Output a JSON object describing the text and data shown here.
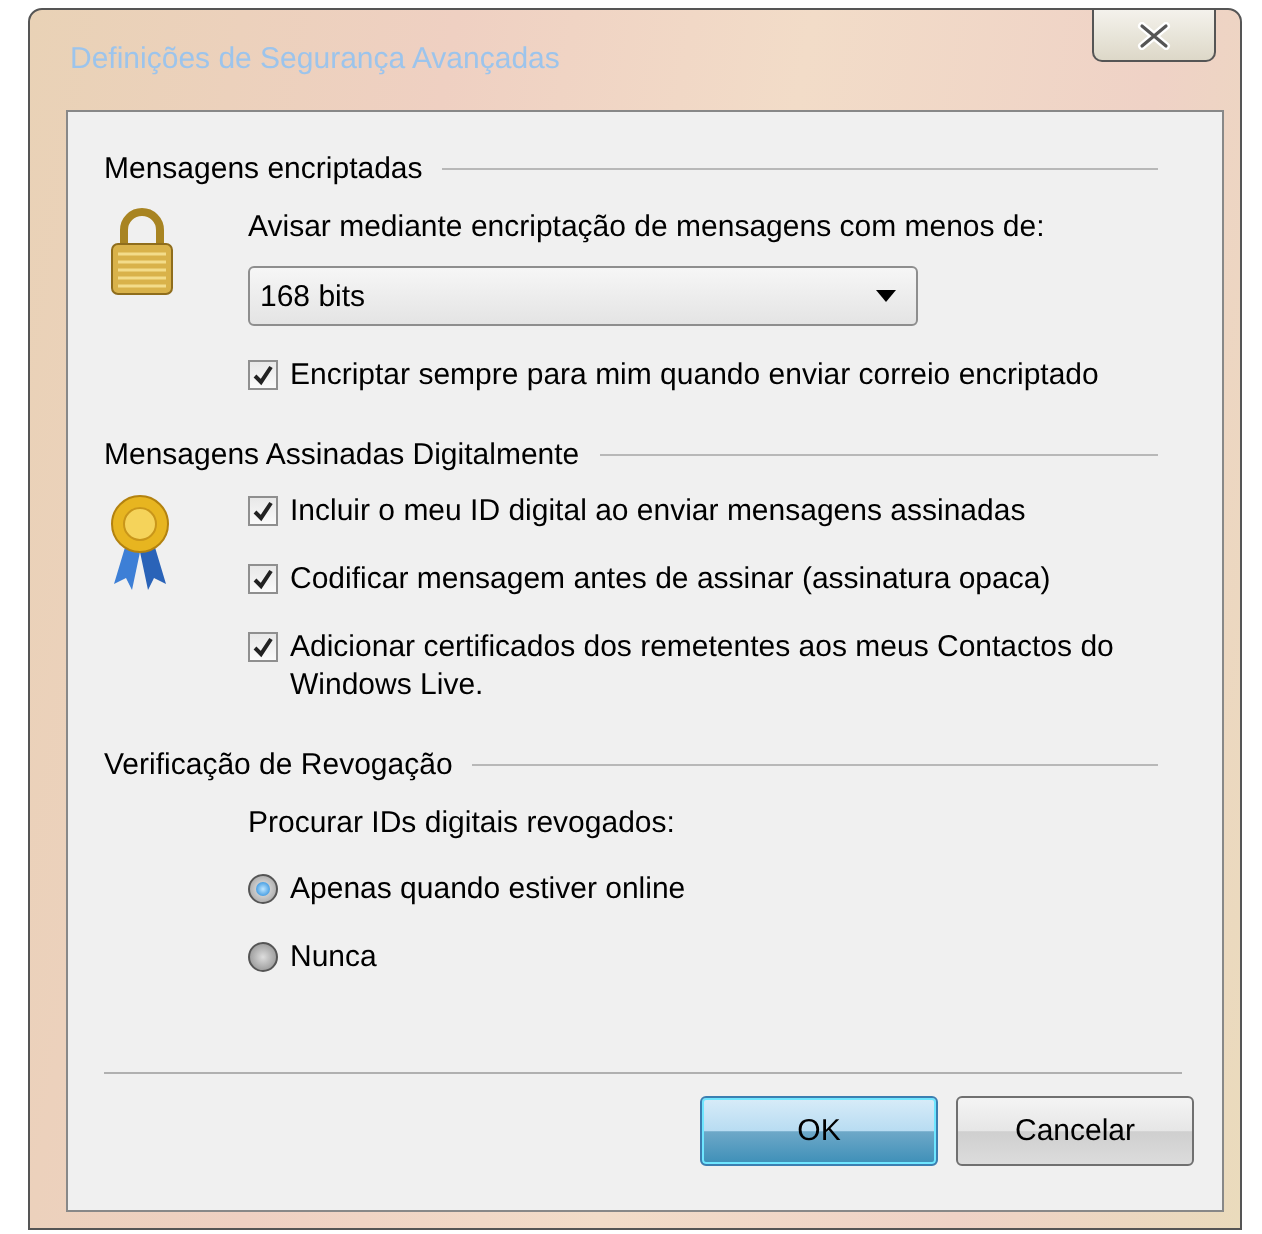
{
  "window": {
    "title": "Definições de Segurança Avançadas"
  },
  "sections": [
    {
      "heading": "Mensagens encriptadas",
      "items": [
        {
          "kind": "label",
          "text": "Avisar mediante encriptação de mensagens com menos de:"
        },
        {
          "kind": "dropdown",
          "value": "168 bits"
        },
        {
          "kind": "checkbox",
          "text": "Encriptar sempre para mim quando enviar correio encriptado",
          "checked": true
        }
      ]
    },
    {
      "heading": "Mensagens Assinadas Digitalmente",
      "items": [
        {
          "kind": "checkbox",
          "text": "Incluir o meu ID digital ao enviar mensagens assinadas",
          "checked": true
        },
        {
          "kind": "checkbox",
          "text": "Codificar mensagem antes de assinar (assinatura opaca)",
          "checked": true
        },
        {
          "kind": "checkbox",
          "text": "Adicionar certificados dos remetentes aos meus Contactos do Windows Live.",
          "checked": true
        }
      ]
    },
    {
      "heading": "Verificação de Revogação",
      "items": [
        {
          "kind": "label",
          "text": "Procurar IDs digitais revogados:"
        },
        {
          "kind": "radio",
          "text": "Apenas quando estiver online",
          "selected": true
        },
        {
          "kind": "radio",
          "text": "Nunca",
          "selected": false
        }
      ]
    }
  ],
  "buttons": [
    {
      "label": "OK",
      "default": true
    },
    {
      "label": "Cancelar",
      "default": false
    }
  ]
}
